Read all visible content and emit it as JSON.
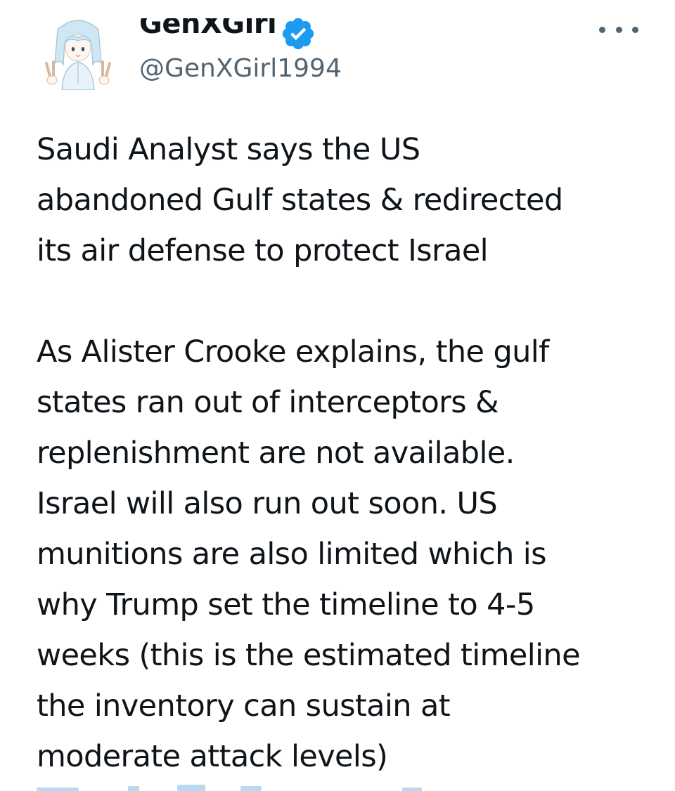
{
  "tweet": {
    "author": {
      "display_name": "GenXGirl",
      "handle": "@GenXGirl1994",
      "verified": true,
      "avatar_icon": "anime-girl-peace-sign-avatar"
    },
    "more_icon": "more-horizontal-icon",
    "paragraphs": [
      [
        "Saudi Analyst says the US",
        "abandoned Gulf states & redirected",
        "its air defense to protect Israel"
      ],
      [
        "As Alister Crooke explains, the gulf",
        "states ran out of interceptors &",
        "replenishment are not available.",
        "Israel will also run out soon. US",
        "munitions are also limited which is",
        "why Trump set the timeline to 4-5",
        "weeks (this is the estimated timeline",
        "the inventory can sustain at",
        "moderate attack levels)"
      ]
    ]
  },
  "colors": {
    "text_primary": "#0f1419",
    "text_secondary": "#536471",
    "verified_blue": "#1d9bf0",
    "link_blue": "#1d9bf0"
  }
}
